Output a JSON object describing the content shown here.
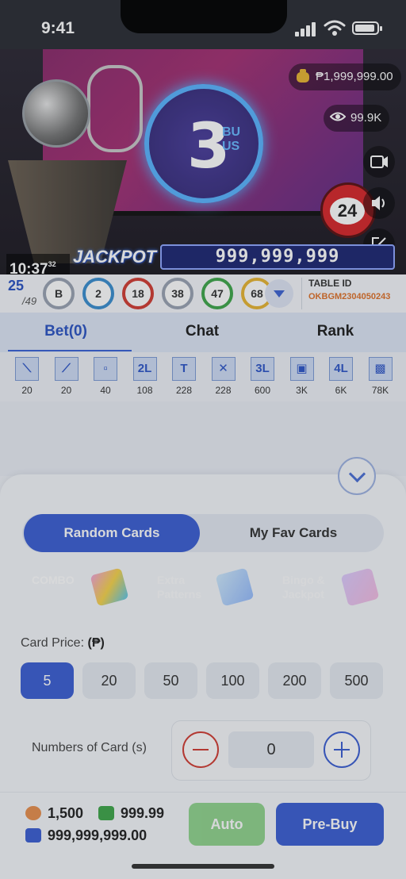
{
  "status_bar": {
    "time": "9:41"
  },
  "video": {
    "screen_number": "3",
    "screen_subtext": "BU\nUS",
    "jackpot_pool": "₱1,999,999.00",
    "viewers": "99.9K",
    "clock": "10:37",
    "clock_seconds": "32",
    "jackpot_label": "JACKPOT",
    "jackpot_value": "999,999,999",
    "ball_numbers": [
      "24",
      "2"
    ]
  },
  "draw_bar": {
    "drawn": "25",
    "total": "/49",
    "balls": [
      {
        "label": "B",
        "color": "#9aa3b2"
      },
      {
        "label": "2",
        "color": "#3a8ed0"
      },
      {
        "label": "18",
        "color": "#d23c33"
      },
      {
        "label": "38",
        "color": "#9aa3b2"
      },
      {
        "label": "47",
        "color": "#3fa64a"
      },
      {
        "label": "68",
        "color": "#e8b531"
      }
    ],
    "table_id_label": "TABLE ID",
    "table_id_value": "OKBGM2304050243"
  },
  "tabs": [
    "Bet(0)",
    "Chat",
    "Rank"
  ],
  "patterns": [
    {
      "icon": "diagonal-pattern-icon",
      "glyph": "⟍",
      "payout": "20"
    },
    {
      "icon": "anti-diagonal-pattern-icon",
      "glyph": "⟋",
      "payout": "20"
    },
    {
      "icon": "corners-pattern-icon",
      "glyph": "▫",
      "payout": "40"
    },
    {
      "icon": "two-lines-pattern-icon",
      "glyph": "2L",
      "payout": "108"
    },
    {
      "icon": "t-pattern-icon",
      "glyph": "T",
      "payout": "228"
    },
    {
      "icon": "x-pattern-icon",
      "glyph": "✕",
      "payout": "228"
    },
    {
      "icon": "three-lines-pattern-icon",
      "glyph": "3L",
      "payout": "600"
    },
    {
      "icon": "frame-pattern-icon",
      "glyph": "▣",
      "payout": "3K"
    },
    {
      "icon": "four-lines-pattern-icon",
      "glyph": "4L",
      "payout": "6K"
    },
    {
      "icon": "blackout-pattern-icon",
      "glyph": "▩",
      "payout": "78K"
    }
  ],
  "card_tabs": {
    "random": "Random Cards",
    "fav": "My Fav Cards"
  },
  "modes": [
    {
      "label": "COMBO",
      "color": "#3b5fd4"
    },
    {
      "label": "Extra\nPatterns",
      "color": "#a9dba6"
    },
    {
      "label": "Bingo &\nJackpot",
      "color": "#f4c89a"
    }
  ],
  "card_price": {
    "label": "Card Price:",
    "currency": "(₱)",
    "options": [
      "5",
      "20",
      "50",
      "100",
      "200",
      "500"
    ],
    "selected": "5"
  },
  "quantity": {
    "label": "Numbers of Card (s)",
    "value": "0"
  },
  "footer": {
    "chips": "1,500",
    "credit": "999.99",
    "wallet": "999,999,999.00",
    "auto_label": "Auto",
    "prebuy_label": "Pre-Buy"
  },
  "colors": {
    "primary": "#3b5fd4",
    "auto_green": "#7fcf7a"
  }
}
